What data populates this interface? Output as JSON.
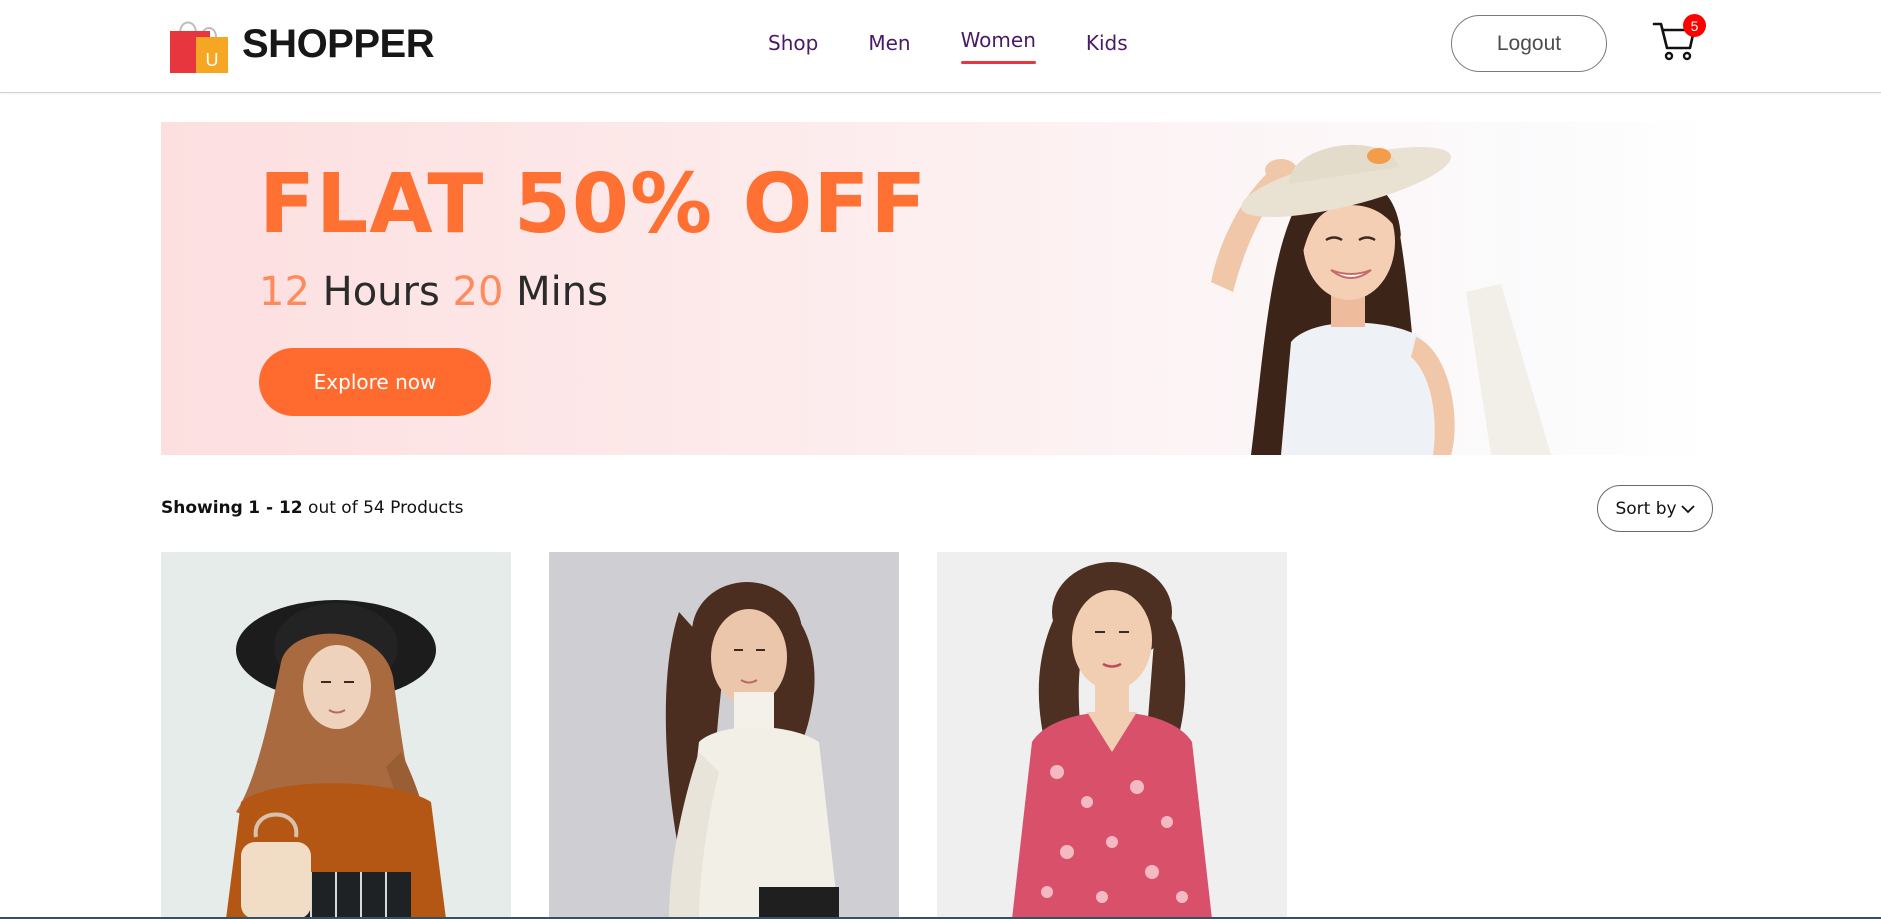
{
  "brand": {
    "name": "SHOPPER",
    "logo_letter": "U"
  },
  "nav": {
    "items": [
      {
        "label": "Shop",
        "active": false
      },
      {
        "label": "Men",
        "active": false
      },
      {
        "label": "Women",
        "active": true
      },
      {
        "label": "Kids",
        "active": false
      }
    ],
    "logout_label": "Logout",
    "cart_count": "5",
    "active_underline_color": "#e8363f"
  },
  "hero": {
    "title": "FLAT 50% OFF",
    "timer": {
      "hours": "12",
      "hours_label": "Hours",
      "mins": "20",
      "mins_label": "Mins"
    },
    "button_label": "Explore now",
    "accent_color": "#ff6b2e"
  },
  "listing": {
    "showing_prefix": "Showing",
    "range": "1 - 12",
    "suffix": "out of 54 Products",
    "sort_label": "Sort by"
  },
  "products": [
    {
      "icon": "product-image-hijab"
    },
    {
      "icon": "product-image-turtleneck"
    },
    {
      "icon": "product-image-floral-dress"
    }
  ]
}
